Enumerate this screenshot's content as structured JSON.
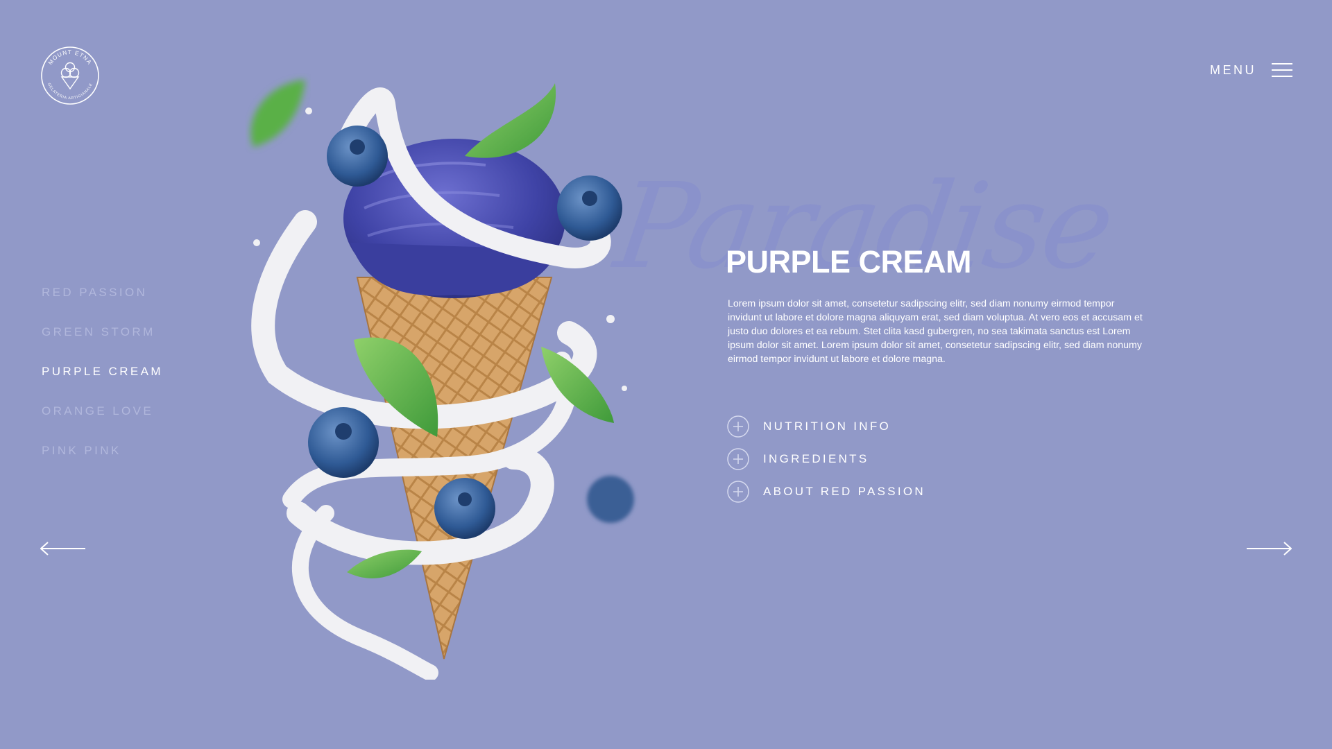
{
  "brand": {
    "logo_top_text": "MOUNT ETNA",
    "logo_bottom_text": "GELATERIA ARTIGIANALE"
  },
  "header": {
    "menu_label": "MENU",
    "menu_icon": "hamburger-icon"
  },
  "flavors": [
    {
      "label": "RED PASSION",
      "active": false
    },
    {
      "label": "GREEN STORM",
      "active": false
    },
    {
      "label": "PURPLE CREAM",
      "active": true
    },
    {
      "label": "ORANGE LOVE",
      "active": false
    },
    {
      "label": "PINK PINK",
      "active": false
    }
  ],
  "navigation": {
    "prev_icon": "arrow-left-icon",
    "next_icon": "arrow-right-icon"
  },
  "hero": {
    "script_word": "Paradise",
    "title": "PURPLE CREAM",
    "description": "Lorem ipsum dolor sit amet, consetetur sadipscing elitr, sed diam nonumy eirmod tempor invidunt ut labore et dolore magna aliquyam erat, sed diam voluptua. At vero eos et accusam et justo duo dolores et ea rebum. Stet clita kasd gubergren, no sea takimata sanctus est Lorem ipsum dolor sit amet. Lorem ipsum dolor sit amet, consetetur sadipscing elitr, sed diam nonumy eirmod tempor invidunt ut labore et dolore magna.",
    "accordion": [
      {
        "label": "NUTRITION INFO",
        "icon": "plus-circle-icon"
      },
      {
        "label": "INGREDIENTS",
        "icon": "plus-circle-icon"
      },
      {
        "label": "ABOUT RED PASSION",
        "icon": "plus-circle-icon"
      }
    ]
  },
  "colors": {
    "background": "#9199c8",
    "text": "#ffffff",
    "inactive_text": "#b1b7dc",
    "script_watermark": "#8890cc"
  }
}
